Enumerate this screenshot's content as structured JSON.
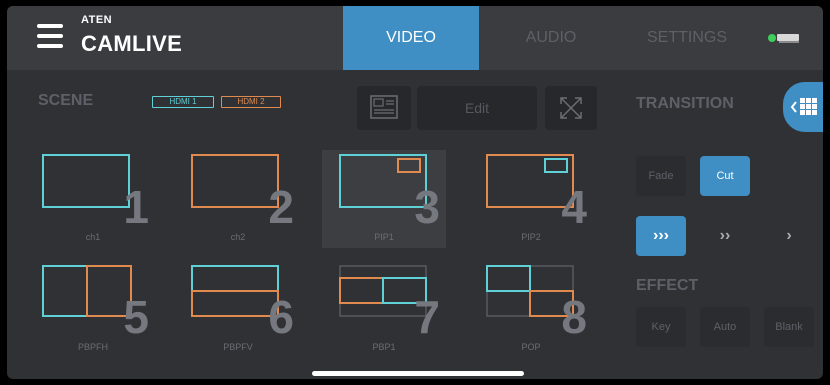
{
  "header": {
    "brand_top": "ATEN",
    "brand": "CAMLIVE",
    "tabs": [
      {
        "label": "VIDEO",
        "active": true
      },
      {
        "label": "AUDIO",
        "active": false
      },
      {
        "label": "SETTINGS",
        "active": false
      }
    ],
    "menu_icon": "hamburger-menu-icon",
    "device_icon": "camera-device-icon"
  },
  "scene_panel": {
    "title": "SCENE",
    "hdmi1": "HDMI 1",
    "hdmi2": "HDMI 2",
    "edit_label": "Edit",
    "scenes": [
      {
        "number": "1",
        "label": "ch1",
        "selected": false
      },
      {
        "number": "2",
        "label": "ch2",
        "selected": false
      },
      {
        "number": "3",
        "label": "PIP1",
        "selected": true
      },
      {
        "number": "4",
        "label": "PIP2",
        "selected": false
      },
      {
        "number": "5",
        "label": "PBPFH",
        "selected": false
      },
      {
        "number": "6",
        "label": "PBPFV",
        "selected": false
      },
      {
        "number": "7",
        "label": "PBP1",
        "selected": false
      },
      {
        "number": "8",
        "label": "POP",
        "selected": false
      }
    ]
  },
  "transition_panel": {
    "title": "TRANSITION",
    "fade_label": "Fade",
    "cut_label": "Cut",
    "active_mode": "Cut",
    "speeds": [
      "fast",
      "medium",
      "slow"
    ],
    "active_speed": "fast",
    "effect_title": "EFFECT",
    "effects": [
      "Key",
      "Auto",
      "Blank"
    ]
  },
  "colors": {
    "accent": "#3f8ec4",
    "hdmi1": "#5fd0d6",
    "hdmi2": "#e08a4f",
    "background": "#2f3135"
  }
}
